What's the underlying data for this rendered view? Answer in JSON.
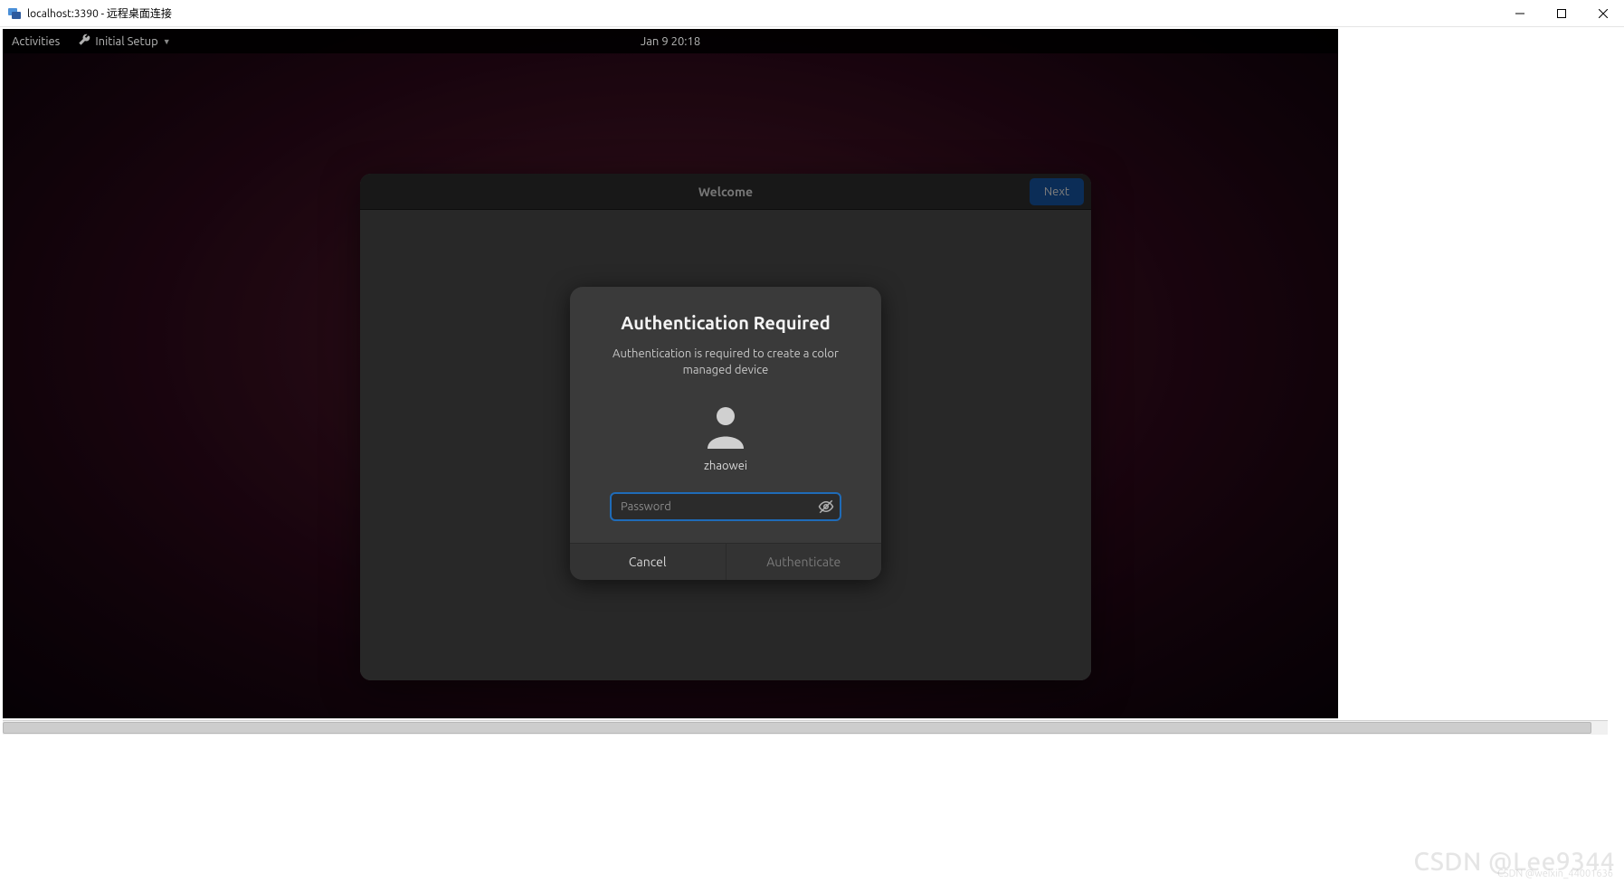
{
  "window": {
    "title": "localhost:3390 - 远程桌面连接"
  },
  "gnome": {
    "activities": "Activities",
    "app_menu": "Initial Setup",
    "clock": "Jan 9  20:18"
  },
  "welcome": {
    "title": "Welcome",
    "next": "Next"
  },
  "auth": {
    "title": "Authentication Required",
    "description": "Authentication is required to create a color managed device",
    "username": "zhaowei",
    "password_placeholder": "Password",
    "cancel": "Cancel",
    "authenticate": "Authenticate"
  },
  "watermark": {
    "main": "CSDN @Lee9344",
    "sub": "CSDN @weixin_44001636"
  }
}
